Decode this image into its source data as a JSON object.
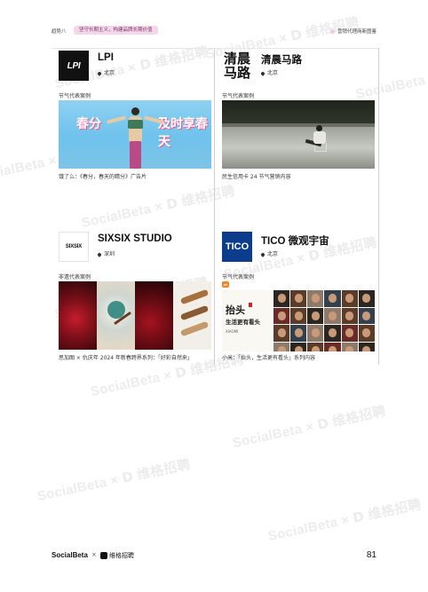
{
  "header": {
    "chapter": "趋势八",
    "pill_text": "坚守长期主义，构建品牌长期价值",
    "section_tag": "营销代理商新图鉴"
  },
  "watermark": {
    "brand": "SocialBeta",
    "partner": "× 𝗗 维格招聘"
  },
  "cards": [
    {
      "logo_text": "LPI",
      "name": "LPI",
      "location": "北京",
      "label": "节气代表案例",
      "media_text": [
        "春分",
        "及时享春天"
      ],
      "caption": "饿了么：《春分，春天的精分》广告片"
    },
    {
      "logo_text": "清晨马路",
      "name": "清晨马路",
      "location": "北京",
      "label": "节气代表案例",
      "caption": "民生信用卡 24 节气营销内容"
    },
    {
      "logo_text": "SIXSIX",
      "name": "SIXSIX STUDIO",
      "location": "深圳",
      "label": "非遗代表案例",
      "caption": "思加图 × 仇庆年 2024 年新春跨界系列：「好彩自然来」"
    },
    {
      "logo_text": "TICO",
      "name": "TICO 微观宇宙",
      "location": "北京",
      "label": "节气代表案例",
      "mi_tag": "mi",
      "media_text": [
        "抬头",
        "生活更有看头",
        "XIAOMI"
      ],
      "caption": "小米：「抬头，生活更有看头」系列内容"
    }
  ],
  "footer": {
    "brand1": "SocialBeta",
    "x": "×",
    "brand2": "维格招聘",
    "page_number": "81"
  }
}
